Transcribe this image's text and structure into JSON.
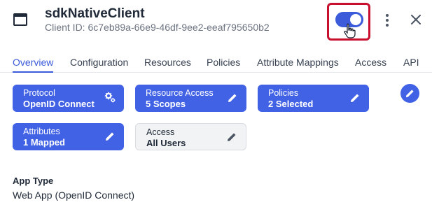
{
  "header": {
    "title": "sdkNativeClient",
    "client_id": "Client ID: 6c7eb89a-66e9-46df-9ee2-eeaf795650b2",
    "toggle_enabled": true,
    "app_icon": "app-window-icon",
    "menu_icon": "more-vertical-icon",
    "close_icon": "close-icon"
  },
  "tabs": [
    {
      "label": "Overview",
      "active": true
    },
    {
      "label": "Configuration",
      "active": false
    },
    {
      "label": "Resources",
      "active": false
    },
    {
      "label": "Policies",
      "active": false
    },
    {
      "label": "Attribute Mappings",
      "active": false
    },
    {
      "label": "Access",
      "active": false
    },
    {
      "label": "API",
      "active": false
    }
  ],
  "chips": {
    "protocol": {
      "label": "Protocol",
      "value": "OpenID Connect",
      "icon": "gear-icon"
    },
    "resource_access": {
      "label": "Resource Access",
      "value": "5 Scopes",
      "icon": "pencil-icon"
    },
    "policies": {
      "label": "Policies",
      "value": "2 Selected",
      "icon": "pencil-icon"
    },
    "attributes": {
      "label": "Attributes",
      "value": "1 Mapped",
      "icon": "pencil-icon"
    },
    "access": {
      "label": "Access",
      "value": "All Users",
      "icon": "pencil-icon"
    }
  },
  "app_type": {
    "label": "App Type",
    "value": "Web App (OpenID Connect)"
  },
  "colors": {
    "accent": "#4262e6",
    "highlight_border": "#c8102e"
  }
}
